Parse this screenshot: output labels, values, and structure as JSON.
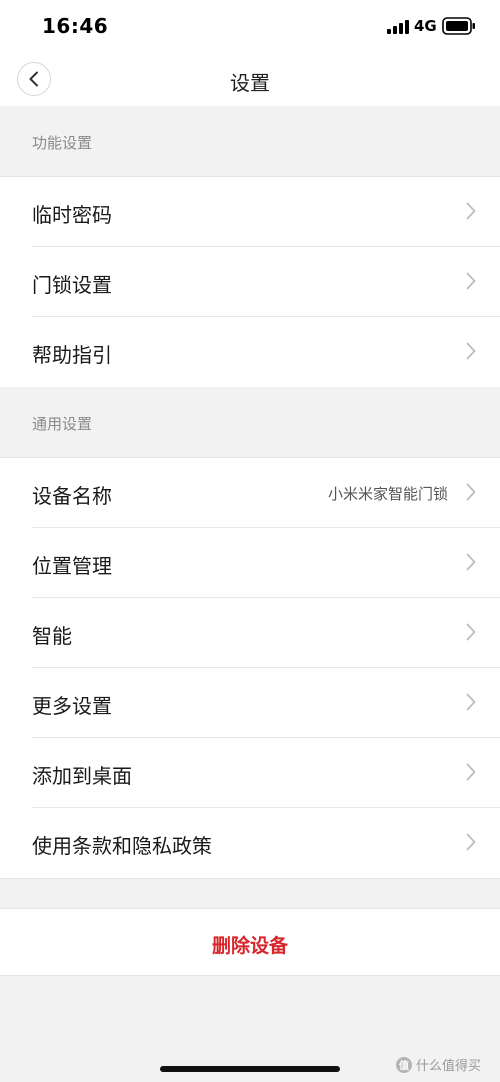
{
  "status_bar": {
    "time": "16:46",
    "network": "4G",
    "icons": [
      "signal-icon",
      "battery-icon"
    ]
  },
  "nav": {
    "back_icon": "chevron-left-icon",
    "title": "设置"
  },
  "sections": [
    {
      "header": "功能设置",
      "items": [
        {
          "label": "临时密码",
          "value": ""
        },
        {
          "label": "门锁设置",
          "value": ""
        },
        {
          "label": "帮助指引",
          "value": ""
        }
      ]
    },
    {
      "header": "通用设置",
      "items": [
        {
          "label": "设备名称",
          "value": "小米米家智能门锁"
        },
        {
          "label": "位置管理",
          "value": ""
        },
        {
          "label": "智能",
          "value": ""
        },
        {
          "label": "更多设置",
          "value": ""
        },
        {
          "label": "添加到桌面",
          "value": ""
        },
        {
          "label": "使用条款和隐私政策",
          "value": ""
        }
      ]
    }
  ],
  "delete_button": "删除设备",
  "watermark": {
    "logo": "值",
    "text": "什么值得买"
  },
  "colors": {
    "accent_red": "#d8262c",
    "background": "#f2f2f2",
    "header_text": "#8a8a8a"
  }
}
